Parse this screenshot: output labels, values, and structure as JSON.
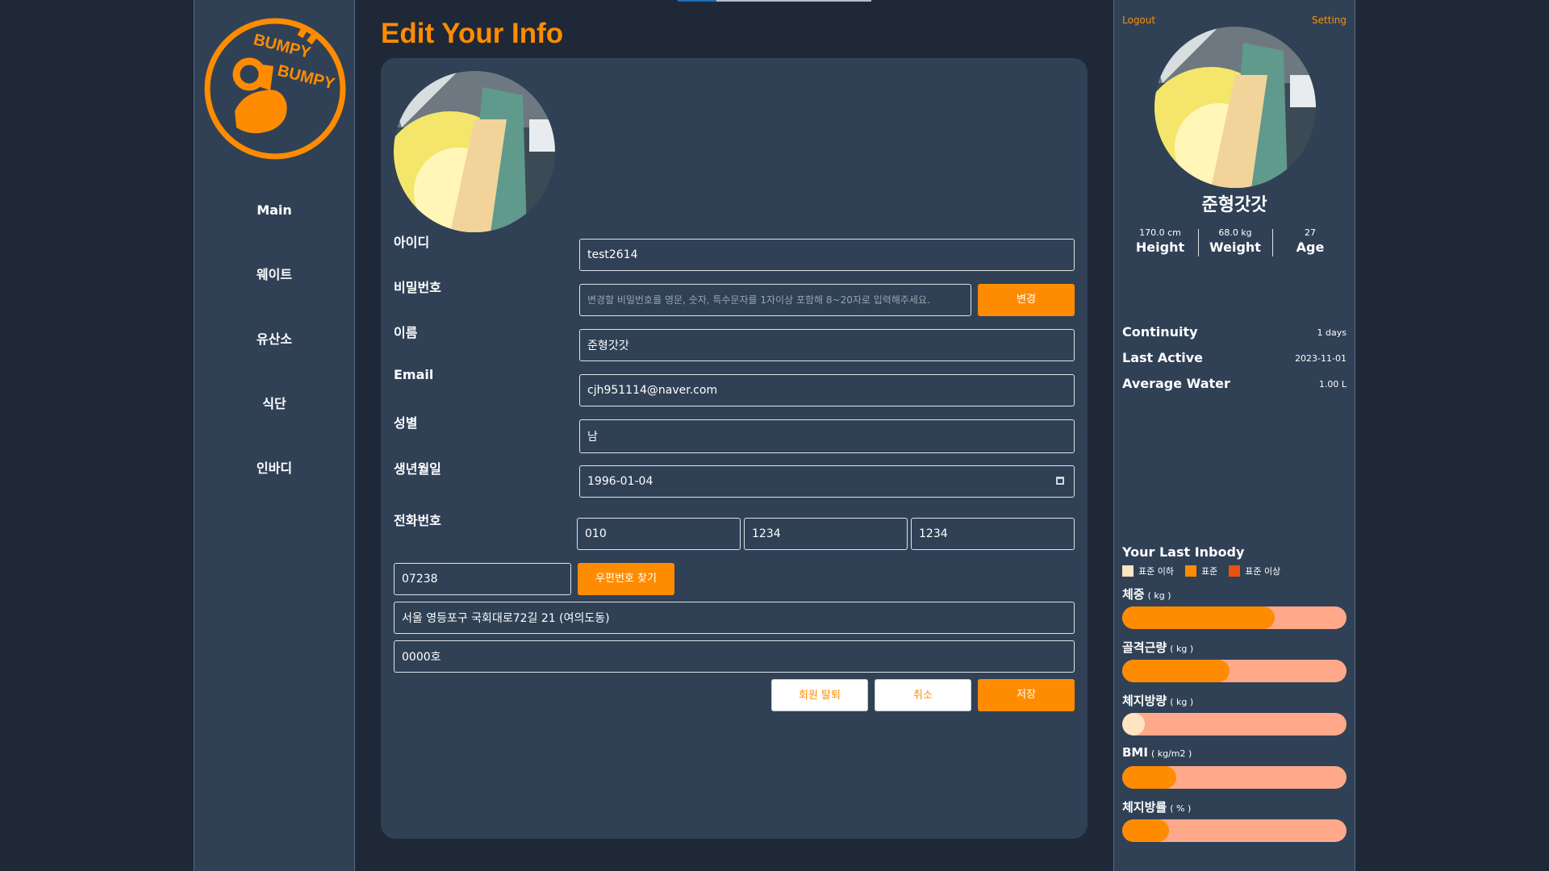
{
  "colors": {
    "accent": "#ff8c00",
    "background": "#1f2837",
    "panel": "#304156",
    "bar_track": "#ffa98a"
  },
  "logo": {
    "line1": "BUMPY",
    "line2": "BUMPY"
  },
  "nav": [
    {
      "label": "Main"
    },
    {
      "label": "웨이트"
    },
    {
      "label": "유산소"
    },
    {
      "label": "식단"
    },
    {
      "label": "인바디"
    }
  ],
  "main": {
    "title": "Edit Your Info",
    "fields": {
      "id_label": "아이디",
      "id_value": "test2614",
      "password_label": "비밀번호",
      "password_placeholder": "변경할 비밀번호를 영문, 숫자, 특수문자를 1자이상 포함해 8~20자로 입력해주세요.",
      "password_button": "변경",
      "name_label": "이름",
      "name_value": "준형갓갓",
      "email_label": "Email",
      "email_value": "cjh951114@naver.com",
      "gender_label": "성별",
      "gender_value": "남",
      "birth_label": "생년월일",
      "birth_value": "1996-01-04",
      "phone_label": "전화번호",
      "phone1": "010",
      "phone2": "1234",
      "phone3": "1234",
      "zip_value": "07238",
      "zip_button": "우편번호 찾기",
      "address_value": "서울 영등포구 국회대로72길 21 (여의도동)",
      "address_detail_value": "0000호"
    },
    "buttons": {
      "withdraw": "회원 탈퇴",
      "cancel": "취소",
      "save": "저장"
    }
  },
  "profile": {
    "logout": "Logout",
    "setting": "Setting",
    "name": "준형갓갓",
    "height_value": "170.0 cm",
    "height_label": "Height",
    "weight_value": "68.0 kg",
    "weight_label": "Weight",
    "age_value": "27",
    "age_label": "Age",
    "continuity_label": "Continuity",
    "continuity_value": "1 days",
    "last_active_label": "Last Active",
    "last_active_value": "2023-11-01",
    "avg_water_label": "Average Water",
    "avg_water_value": "1.00 L"
  },
  "inbody": {
    "title": "Your Last Inbody",
    "legend": [
      {
        "label": "표준 이하",
        "color": "#ffe4c4"
      },
      {
        "label": "표준",
        "color": "#ff8c00"
      },
      {
        "label": "표준 이상",
        "color": "#e8530f"
      }
    ],
    "bars": [
      {
        "label": "체중",
        "unit": "( kg )",
        "fill_percent": 68,
        "color": "#ff8c00"
      },
      {
        "label": "골격근량",
        "unit": "( kg )",
        "fill_percent": 48,
        "color": "#ff8c00"
      },
      {
        "label": "체지방량",
        "unit": "( kg )",
        "fill_percent": 10,
        "color": "#ffe4c4"
      },
      {
        "label": "BMI",
        "unit": "( kg/m2 )",
        "fill_percent": 24,
        "color": "#ff8c00"
      },
      {
        "label": "체지방률",
        "unit": "( % )",
        "fill_percent": 21,
        "color": "#ff8c00"
      }
    ]
  }
}
